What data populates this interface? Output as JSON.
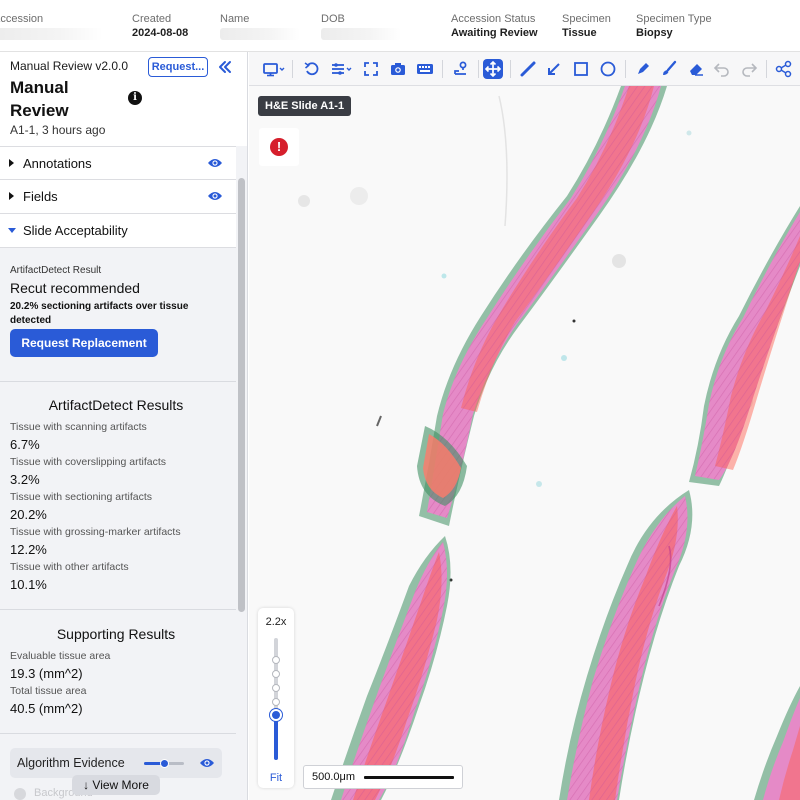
{
  "header": {
    "columns": [
      {
        "label": "Accession",
        "value": ""
      },
      {
        "label": "Created",
        "value": "2024-08-08"
      },
      {
        "label": "Name",
        "value": ""
      },
      {
        "label": "DOB",
        "value": ""
      },
      {
        "label": "Accession Status",
        "value": "Awaiting Review"
      },
      {
        "label": "Specimen",
        "value": "Tissue"
      },
      {
        "label": "Specimen Type",
        "value": "Biopsy"
      }
    ]
  },
  "panel": {
    "version": "Manual Review v2.0.0",
    "title": "Manual Review",
    "subtitle": "A1-1, 3 hours ago",
    "request_button": "Request...",
    "sections": {
      "annotations": "Annotations",
      "fields": "Fields",
      "slide_acceptability": "Slide Acceptability"
    },
    "acceptability": {
      "label": "ArtifactDetect Result",
      "headline": "Recut recommended",
      "description": "20.2% sectioning artifacts over tissue detected",
      "button": "Request Replacement"
    },
    "artifact_results": {
      "title": "ArtifactDetect Results",
      "items": [
        {
          "label": "Tissue with scanning artifacts",
          "value": "6.7%"
        },
        {
          "label": "Tissue with coverslipping artifacts",
          "value": "3.2%"
        },
        {
          "label": "Tissue with sectioning artifacts",
          "value": "20.2%"
        },
        {
          "label": "Tissue with grossing-marker artifacts",
          "value": "12.2%"
        },
        {
          "label": "Tissue with other artifacts",
          "value": "10.1%"
        }
      ]
    },
    "supporting_results": {
      "title": "Supporting Results",
      "items": [
        {
          "label": "Evaluable tissue area",
          "value": "19.3 (mm^2)"
        },
        {
          "label": "Total tissue area",
          "value": "40.5 (mm^2)"
        }
      ]
    },
    "evidence": {
      "label": "Algorithm Evidence",
      "opacity": 0.5,
      "view_more": "↓ View More",
      "hidden_item": "Background"
    }
  },
  "viewer": {
    "slide_label": "H&E Slide A1-1",
    "zoom": "2.2x",
    "zoom_fraction": 0.35,
    "fit_label": "Fit",
    "scale_label": "500.0μm",
    "alert_symbol": "!"
  },
  "toolbar": {
    "icons": [
      "monitor-icon",
      "rotate-icon",
      "layers-icon",
      "fullscreen-icon",
      "camera-icon",
      "keyboard-icon",
      "pin-icon",
      "move-icon",
      "ruler-icon",
      "arrow-icon",
      "rectangle-icon",
      "circle-icon",
      "pen-icon",
      "brush-icon",
      "eraser-icon",
      "undo-icon",
      "redo-icon",
      "share-icon"
    ],
    "active": "move-icon"
  },
  "colors": {
    "accent": "#2a5bd7",
    "alert": "#d61f2c",
    "tissue_pink": "#e58ac7",
    "artifact_red": "#ff5a4a",
    "artifact_green": "#3f8f62"
  }
}
